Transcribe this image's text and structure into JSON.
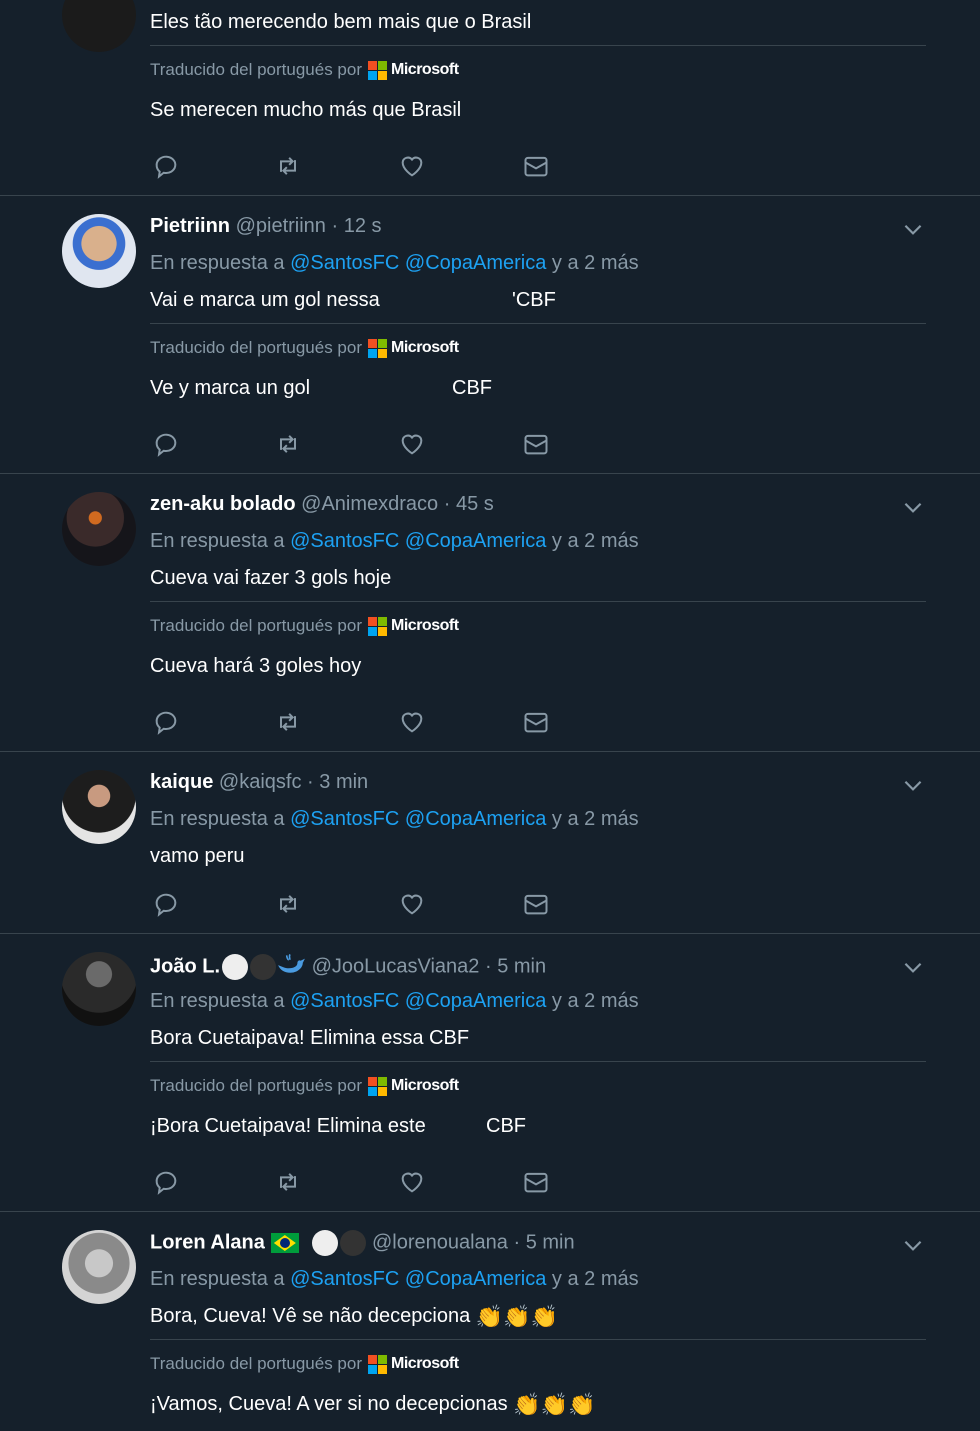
{
  "colors": {
    "bg": "#15202b",
    "text": "#ffffff",
    "muted": "#8899a6",
    "link": "#1da1f2",
    "border": "#38444d"
  },
  "icons": {
    "reply": "reply-icon",
    "retweet": "retweet-icon",
    "like": "heart-icon",
    "dm": "envelope-icon",
    "more": "chevron-down-icon"
  },
  "translation": {
    "label": "Traducido del portugués por",
    "brand": "Microsoft"
  },
  "reply_prefix": "En respuesta a",
  "reply_mention1": "@SantosFC",
  "reply_mention2": "@CopaAmerica",
  "reply_suffix": "y a 2 más",
  "tweets": [
    {
      "text": "Eles tão merecendo bem mais que o Brasil",
      "translated": "Se merecen mucho más que Brasil"
    },
    {
      "name": "Pietriinn",
      "handle": "@pietriinn",
      "time": "· 12 s",
      "text": "Vai e marca um gol nessa",
      "text_tail": "'CBF",
      "translated": "Ve y marca un gol",
      "translated_tail": "CBF"
    },
    {
      "name": "zen-aku bolado",
      "handle": "@Animexdraco",
      "time": "· 45 s",
      "text": "Cueva vai fazer 3 gols hoje",
      "translated": "Cueva hará 3 goles hoy"
    },
    {
      "name": "kaique",
      "handle": "@kaiqsfc",
      "time": "· 3 min",
      "text": "vamo peru"
    },
    {
      "name": "João L.",
      "handle": "@JooLucasViana2",
      "time": "· 5 min",
      "text": "Bora Cuetaipava! Elimina essa CBF",
      "translated": "¡Bora Cuetaipava! Elimina este",
      "translated_tail": "CBF"
    },
    {
      "name": "Loren Alana",
      "handle": "@lorenoualana",
      "time": "· 5 min",
      "text": "Bora, Cueva! Vê se não decepciona",
      "text_emoji": "👏👏👏",
      "translated": "¡Vamos, Cueva! A ver si no decepcionas",
      "translated_emoji": "👏👏👏"
    }
  ]
}
